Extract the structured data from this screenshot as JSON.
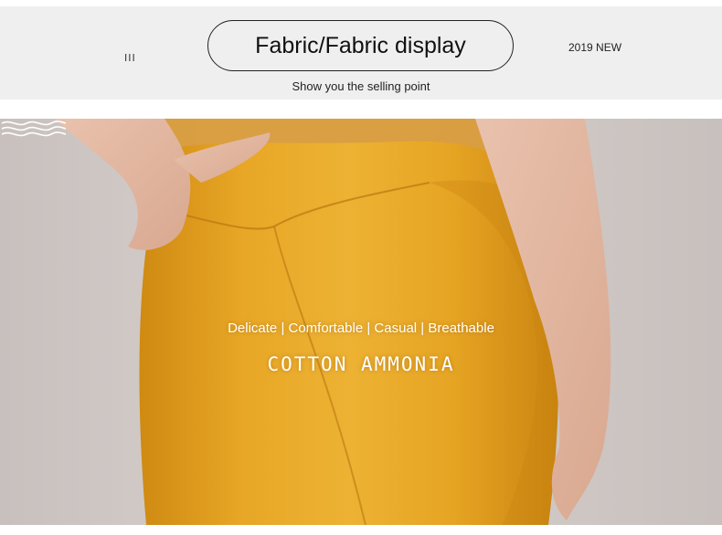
{
  "header": {
    "left_mark": "III",
    "title": "Fabric/Fabric display",
    "year_tag": "2019 NEW",
    "subtitle": "Show you the selling point"
  },
  "photo": {
    "description_icon": "wave-lines-icon",
    "features_line": "Delicate | Comfortable | Casual | Breathable",
    "material": "COTTON AMMONIA"
  },
  "colors": {
    "header_bg": "#efefef",
    "fabric_yellow": "#e7a421",
    "backdrop": "#d3cbc8"
  }
}
